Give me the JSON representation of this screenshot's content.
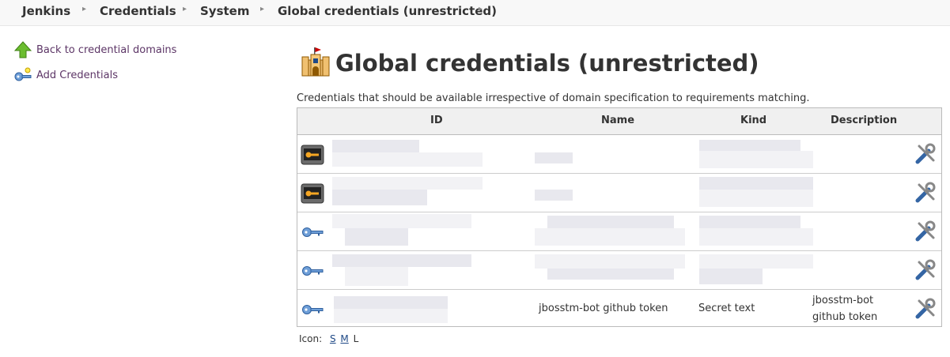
{
  "breadcrumbs": [
    "Jenkins",
    "Credentials",
    "System",
    "Global credentials (unrestricted)"
  ],
  "sidebar": {
    "back_label": "Back to credential domains",
    "add_label": "Add Credentials"
  },
  "main": {
    "title": "Global credentials (unrestricted)",
    "description": "Credentials that should be available irrespective of domain specification to requirements matching.",
    "table": {
      "headers": [
        "ID",
        "Name",
        "Kind",
        "Description"
      ],
      "rows": [
        {
          "icon": "ssh-key-icon",
          "id": "",
          "name": "",
          "kind": "",
          "description": ""
        },
        {
          "icon": "ssh-key-icon",
          "id": "",
          "name": "",
          "kind": "",
          "description": ""
        },
        {
          "icon": "key-icon",
          "id": "",
          "name": "",
          "kind": "",
          "description": ""
        },
        {
          "icon": "key-icon",
          "id": "",
          "name": "",
          "kind": "",
          "description": ""
        },
        {
          "icon": "key-icon",
          "id": "",
          "name": "jbosstm-bot github token",
          "kind": "Secret text",
          "description_line1": "jbosstm-bot",
          "description_line2": "github token"
        }
      ]
    },
    "icon_size": {
      "label": "Icon:",
      "options": [
        "S",
        "M",
        "L"
      ],
      "current": "L"
    }
  },
  "colors": {
    "link": "#5c3566",
    "header_bg": "#f0f0f0",
    "icon_link": "#204a87"
  }
}
